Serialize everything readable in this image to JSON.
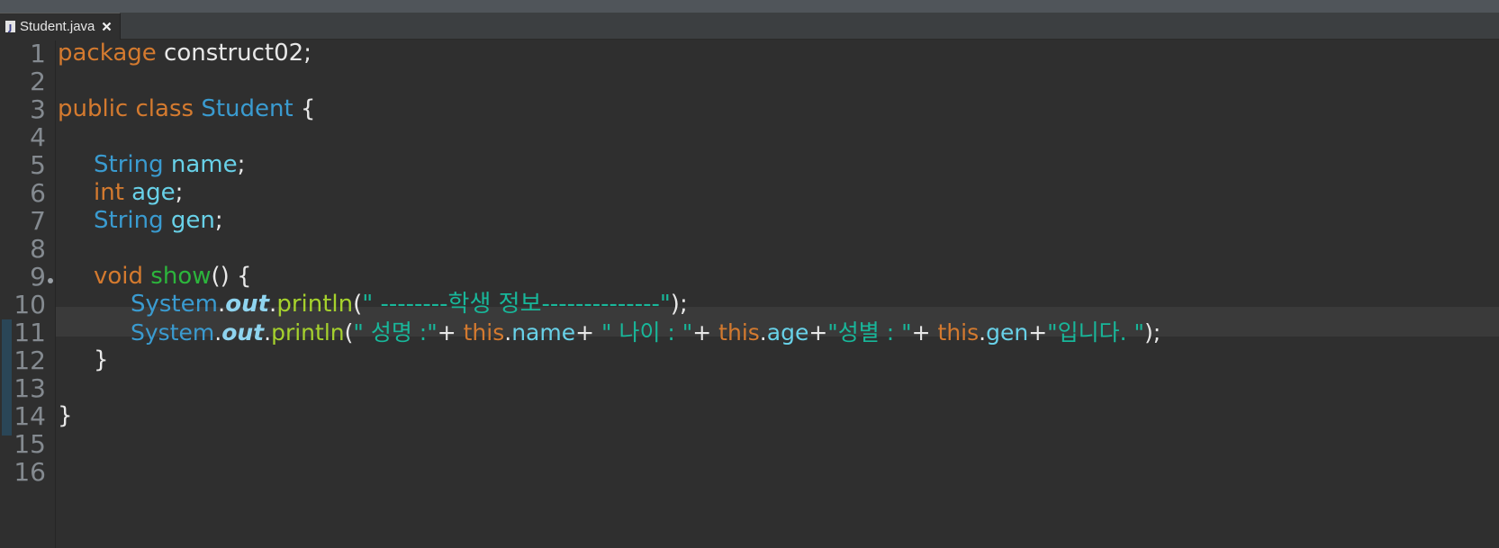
{
  "tab": {
    "file_icon_letter": "J",
    "label": "Student.java"
  },
  "gutter": {
    "line_numbers": [
      "1",
      "2",
      "3",
      "4",
      "5",
      "6",
      "7",
      "8",
      "9",
      "10",
      "11",
      "12",
      "13",
      "14",
      "15",
      "16"
    ]
  },
  "code": {
    "l1": {
      "kw": "package",
      "rest": " construct02;"
    },
    "l3": {
      "kw": "public class",
      "type": "Student",
      "rest": " {"
    },
    "l5": {
      "type": "String",
      "field": "name",
      "rest": ";"
    },
    "l6": {
      "kw": "int",
      "field": "age",
      "rest": ";"
    },
    "l7": {
      "type": "String",
      "field": "gen",
      "rest": ";"
    },
    "l9": {
      "kw": "void",
      "method": "show",
      "rest": "() {"
    },
    "l10": {
      "system": "System",
      "dot1": ".",
      "out": "out",
      "dot2": ".",
      "println": "println",
      "open": "(",
      "str": "\" --------학생 정보--------------\"",
      "close": ");"
    },
    "l11": {
      "system": "System",
      "dot1": ".",
      "out": "out",
      "dot2": ".",
      "println": "println",
      "open": "(",
      "str1": "\" 성명 :\"",
      "plus1": "+ ",
      "this1": "this",
      "dot_a": ".",
      "name": "name",
      "plus2": "+ ",
      "str2": "\" 나이 : \"",
      "plus3": "+ ",
      "this2": "this",
      "dot_b": ".",
      "age": "age",
      "plus4": "+",
      "str3": "\"성별 : \"",
      "plus5": "+ ",
      "this3": "this",
      "dot_c": ".",
      "gen": "gen",
      "plus6": "+",
      "str4": "\"입니다. \"",
      "close": ");"
    },
    "l12": {
      "text": "}"
    },
    "l14": {
      "text": "}"
    }
  },
  "colors": {
    "keyword": "#d47a2f",
    "type": "#3a9bd0",
    "field": "#68d1e8",
    "method_decl": "#2cb53c",
    "method_call": "#a5d12d",
    "string": "#18b79a",
    "background": "#2f2f2f",
    "current_line": "#3a3a3a"
  }
}
